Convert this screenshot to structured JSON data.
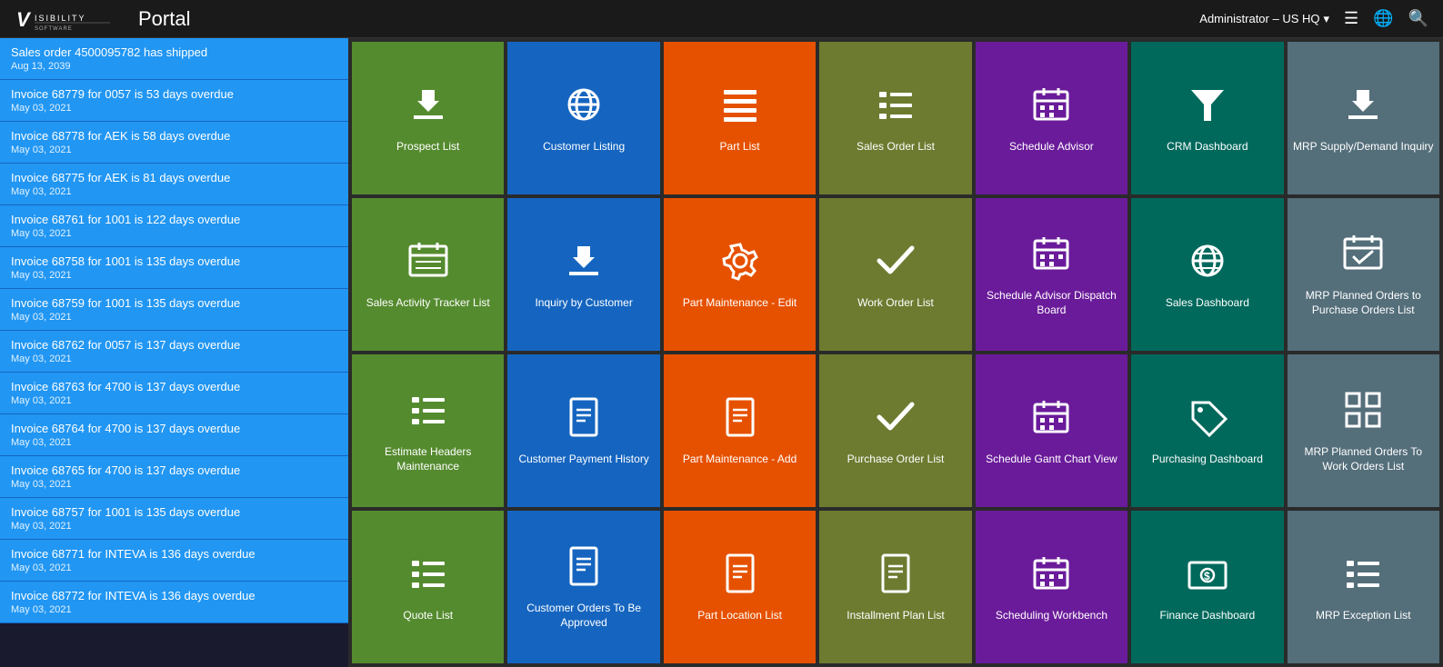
{
  "header": {
    "logo_text": "V",
    "logo_sub": "VISIBILITY",
    "portal_label": "Portal",
    "user_label": "Administrator – US HQ",
    "user_dropdown_arrow": "▾",
    "icons": {
      "menu": "☰",
      "globe": "🌐",
      "search": "🔍"
    }
  },
  "sidebar": {
    "items": [
      {
        "title": "Sales order 4500095782 has shipped",
        "date": "Aug 13, 2039"
      },
      {
        "title": "Invoice 68779 for 0057 is 53 days overdue",
        "date": "May 03, 2021"
      },
      {
        "title": "Invoice 68778 for AEK is 58 days overdue",
        "date": "May 03, 2021"
      },
      {
        "title": "Invoice 68775 for AEK is 81 days overdue",
        "date": "May 03, 2021"
      },
      {
        "title": "Invoice 68761 for 1001 is 122 days overdue",
        "date": "May 03, 2021"
      },
      {
        "title": "Invoice 68758 for 1001 is 135 days overdue",
        "date": "May 03, 2021"
      },
      {
        "title": "Invoice 68759 for 1001 is 135 days overdue",
        "date": "May 03, 2021"
      },
      {
        "title": "Invoice 68762 for 0057 is 137 days overdue",
        "date": "May 03, 2021"
      },
      {
        "title": "Invoice 68763 for 4700 is 137 days overdue",
        "date": "May 03, 2021"
      },
      {
        "title": "Invoice 68764 for 4700 is 137 days overdue",
        "date": "May 03, 2021"
      },
      {
        "title": "Invoice 68765 for 4700 is 137 days overdue",
        "date": "May 03, 2021"
      },
      {
        "title": "Invoice 68757 for 1001 is 135 days overdue",
        "date": "May 03, 2021"
      },
      {
        "title": "Invoice 68771 for INTEVA is 136 days overdue",
        "date": "May 03, 2021"
      },
      {
        "title": "Invoice 68772 for INTEVA is 136 days overdue",
        "date": "May 03, 2021"
      }
    ]
  },
  "tiles": [
    {
      "id": "prospect-list",
      "label": "Prospect List",
      "color": "tile-green",
      "icon": "download"
    },
    {
      "id": "customer-listing",
      "label": "Customer Listing",
      "color": "tile-blue",
      "icon": "globe"
    },
    {
      "id": "part-list",
      "label": "Part List",
      "color": "tile-orange",
      "icon": "list"
    },
    {
      "id": "sales-order-list",
      "label": "Sales Order List",
      "color": "tile-olive",
      "icon": "list-lines"
    },
    {
      "id": "schedule-advisor",
      "label": "Schedule Advisor",
      "color": "tile-purple",
      "icon": "calendar"
    },
    {
      "id": "crm-dashboard",
      "label": "CRM Dashboard",
      "color": "tile-teal",
      "icon": "funnel"
    },
    {
      "id": "mrp-supply-demand",
      "label": "MRP Supply/Demand Inquiry",
      "color": "tile-gray",
      "icon": "download"
    },
    {
      "id": "sales-activity-tracker",
      "label": "Sales Activity Tracker List",
      "color": "tile-green",
      "icon": "calendar-list"
    },
    {
      "id": "inquiry-by-customer",
      "label": "Inquiry by Customer",
      "color": "tile-blue",
      "icon": "download"
    },
    {
      "id": "part-maintenance-edit",
      "label": "Part Maintenance - Edit",
      "color": "tile-orange",
      "icon": "gear"
    },
    {
      "id": "work-order-list",
      "label": "Work Order List",
      "color": "tile-olive",
      "icon": "check"
    },
    {
      "id": "schedule-advisor-dispatch",
      "label": "Schedule Advisor Dispatch Board",
      "color": "tile-purple",
      "icon": "calendar"
    },
    {
      "id": "sales-dashboard",
      "label": "Sales Dashboard",
      "color": "tile-teal",
      "icon": "globe"
    },
    {
      "id": "mrp-planned-orders-purchase",
      "label": "MRP Planned Orders to Purchase Orders List",
      "color": "tile-gray",
      "icon": "calendar-check"
    },
    {
      "id": "estimate-headers",
      "label": "Estimate Headers Maintenance",
      "color": "tile-green",
      "icon": "list-lines"
    },
    {
      "id": "customer-payment-history",
      "label": "Customer Payment History",
      "color": "tile-blue",
      "icon": "document"
    },
    {
      "id": "part-maintenance-add",
      "label": "Part Maintenance - Add",
      "color": "tile-orange",
      "icon": "document"
    },
    {
      "id": "purchase-order-list",
      "label": "Purchase Order List",
      "color": "tile-olive",
      "icon": "check"
    },
    {
      "id": "schedule-gantt",
      "label": "Schedule Gantt Chart View",
      "color": "tile-purple",
      "icon": "calendar"
    },
    {
      "id": "purchasing-dashboard",
      "label": "Purchasing Dashboard",
      "color": "tile-teal",
      "icon": "tag"
    },
    {
      "id": "mrp-planned-orders-work",
      "label": "MRP Planned Orders To Work Orders List",
      "color": "tile-gray",
      "icon": "grid"
    },
    {
      "id": "quote-list",
      "label": "Quote List",
      "color": "tile-green",
      "icon": "list-lines"
    },
    {
      "id": "customer-orders-approved",
      "label": "Customer Orders To Be Approved",
      "color": "tile-blue",
      "icon": "document"
    },
    {
      "id": "part-location-list",
      "label": "Part Location List",
      "color": "tile-orange",
      "icon": "document"
    },
    {
      "id": "installment-plan-list",
      "label": "Installment Plan List",
      "color": "tile-olive",
      "icon": "document"
    },
    {
      "id": "scheduling-workbench",
      "label": "Scheduling Workbench",
      "color": "tile-purple",
      "icon": "calendar"
    },
    {
      "id": "finance-dashboard",
      "label": "Finance Dashboard",
      "color": "tile-teal",
      "icon": "money"
    },
    {
      "id": "mrp-exception-list",
      "label": "MRP Exception List",
      "color": "tile-gray",
      "icon": "list-lines"
    }
  ]
}
